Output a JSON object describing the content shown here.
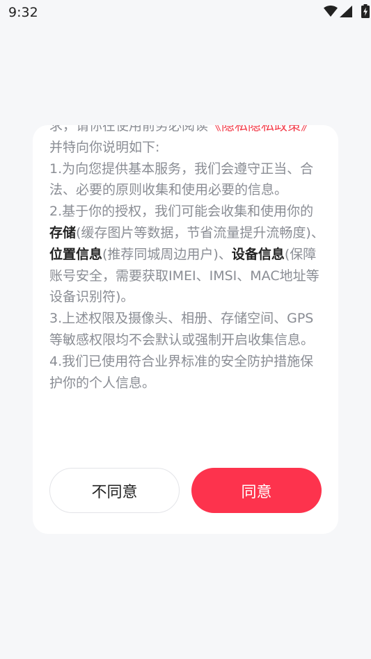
{
  "status_bar": {
    "time": "9:32",
    "icons": [
      "wifi-icon",
      "cellular-signal-icon",
      "battery-charging-icon"
    ]
  },
  "dialog": {
    "paragraphs": [
      {
        "pre": "求，请你在使用前务必阅读",
        "link": "《隐私隐私政策》",
        "post": "并特向你说明如下:"
      },
      {
        "text": "1.为向您提供基本服务，我们会遵守正当、合法、必要的原则收集和使用必要的信息。"
      },
      {
        "p1": "2.基于你的授权，我们可能会收集和使用你的",
        "k1": "存储",
        "p2": "(缓存图片等数据，节省流量提升流畅度)、",
        "k2": "位置信息",
        "p3": "(推荐同城周边用户)、",
        "k3": "设备信息",
        "p4": "(保障账号安全，需要获取IMEI、IMSI、MAC地址等设备识别符)。"
      },
      {
        "text": "3.上述权限及摄像头、相册、存储空间、GPS等敏感权限均不会默认或强制开启收集信息。"
      },
      {
        "text": "4.我们已使用符合业界标准的安全防护措施保护你的个人信息。"
      }
    ],
    "disagree_label": "不同意",
    "agree_label": "同意"
  },
  "colors": {
    "accent": "#fd334d",
    "link": "#f23b49",
    "body_text": "#8a8d94",
    "background": "#f6f7f9"
  }
}
